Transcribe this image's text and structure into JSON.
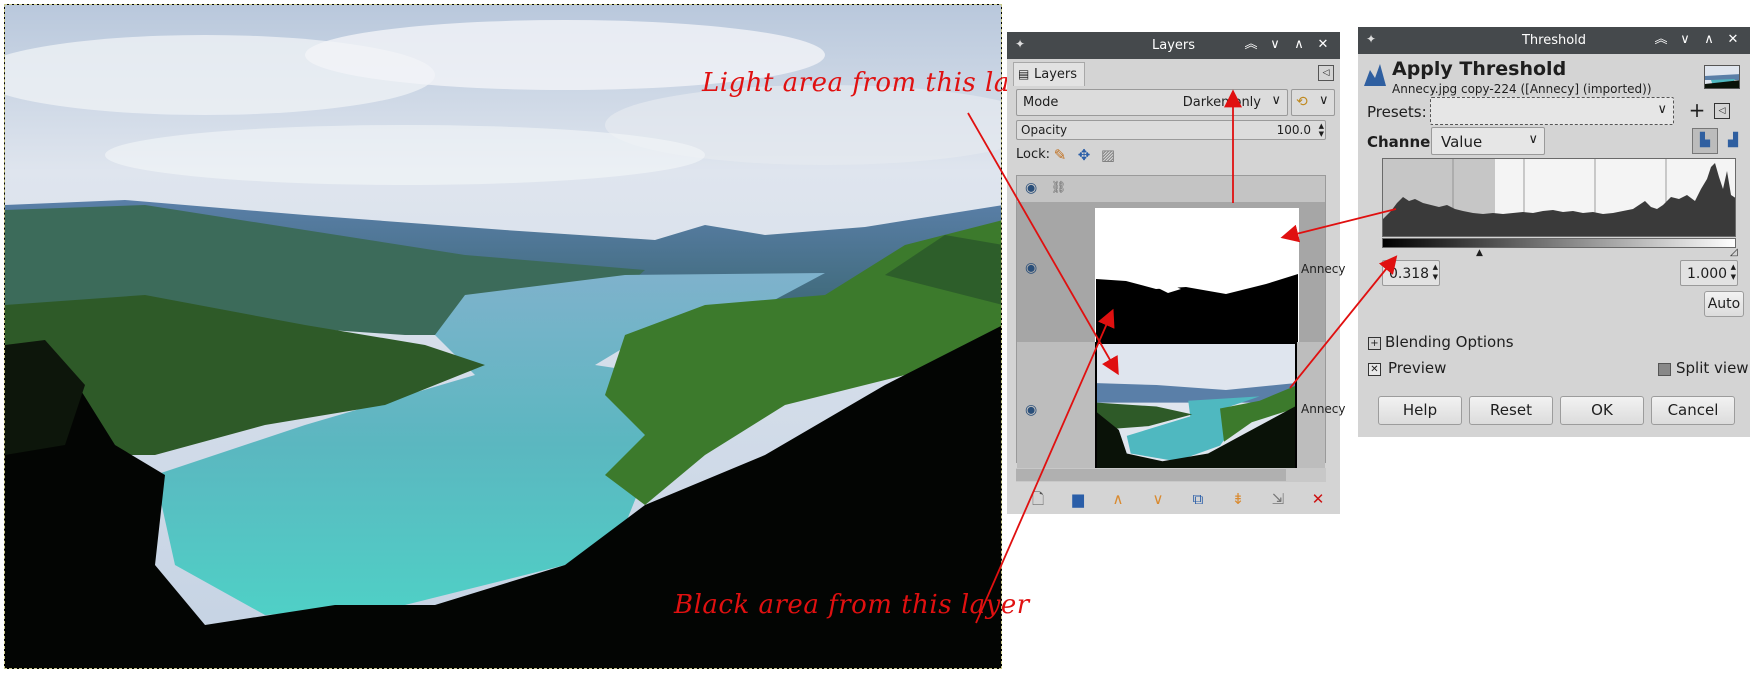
{
  "annotations": {
    "light": "Light area from this layer",
    "black": "Black area from this layer"
  },
  "layers_dock": {
    "title": "Layers",
    "tab_label": "Layers",
    "mode_label": "Mode",
    "mode_value": "Darken only",
    "opacity_label": "Opacity",
    "opacity_value": "100.0",
    "lock_label": "Lock:",
    "layers": [
      {
        "name": "Annecy",
        "thumb": "threshold"
      },
      {
        "name": "Annecy",
        "thumb": "photo"
      }
    ]
  },
  "threshold_dialog": {
    "window_title": "Threshold",
    "heading": "Apply Threshold",
    "subtitle": "Annecy.jpg copy-224 ([Annecy] (imported))",
    "presets_label": "Presets:",
    "channel_label": "Channel:",
    "channel_value": "Value",
    "low_value": "0.318",
    "high_value": "1.000",
    "auto_label": "Auto",
    "blending_label": "Blending Options",
    "preview_label": "Preview",
    "split_view_label": "Split view",
    "buttons": {
      "help": "Help",
      "reset": "Reset",
      "ok": "OK",
      "cancel": "Cancel"
    }
  },
  "colors": {
    "titlebar": "#45494c",
    "panel": "#d4d4d4",
    "annotation": "#e01010",
    "sky": "#cfd8e4",
    "lake": "#4fb8b8"
  },
  "icons": [
    "gimp-eye-icon",
    "chain-icon",
    "paint-lock-icon",
    "move-lock-icon",
    "alpha-lock-icon",
    "new-layer-icon",
    "new-group-icon",
    "raise-icon",
    "lower-icon",
    "duplicate-icon",
    "anchor-icon",
    "merge-icon",
    "delete-icon",
    "plus-icon",
    "linear-histogram-icon",
    "log-histogram-icon"
  ]
}
